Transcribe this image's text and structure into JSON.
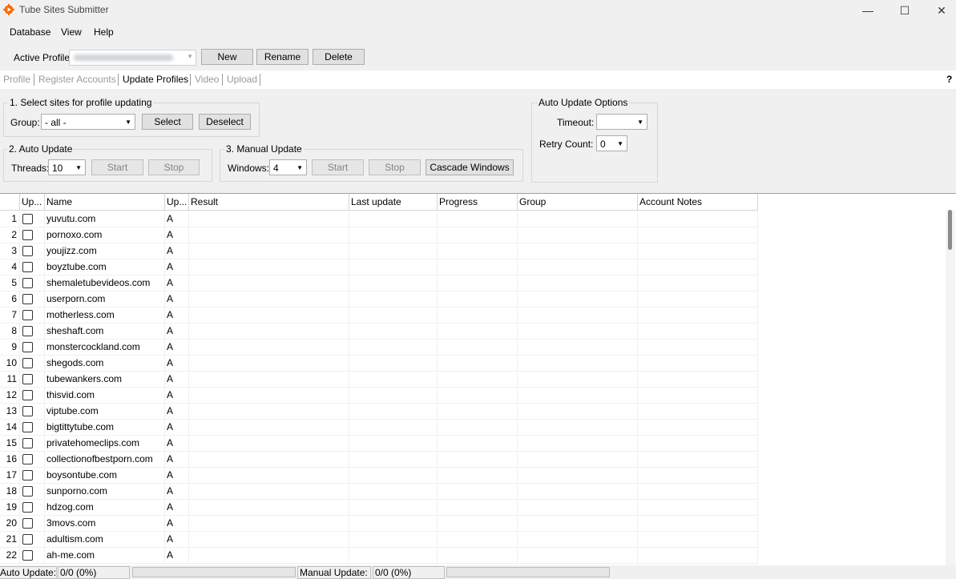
{
  "window": {
    "title": "Tube Sites Submitter",
    "minimize_glyph": "—",
    "maximize_glyph": "☐",
    "close_glyph": "✕",
    "icon": "app-gear-icon",
    "icon_color": "#ff6a00"
  },
  "menu": [
    "Database",
    "View",
    "Help"
  ],
  "profile": {
    "label": "Active Profile:",
    "buttons": {
      "new": "New",
      "rename": "Rename",
      "delete": "Delete"
    }
  },
  "tabs": [
    {
      "label": "Profile",
      "active": false
    },
    {
      "label": "Register Accounts",
      "active": false
    },
    {
      "label": "Update Profiles",
      "active": true
    },
    {
      "label": "Video",
      "active": false
    },
    {
      "label": "Upload",
      "active": false
    }
  ],
  "help_label": "?",
  "select_sites": {
    "title": "1. Select sites for profile updating",
    "group_label": "Group:",
    "group_value": "- all -",
    "select_button": "Select",
    "deselect_button": "Deselect"
  },
  "auto_update": {
    "title": "2. Auto Update",
    "threads_label": "Threads:",
    "threads_value": "10",
    "start_button": "Start",
    "stop_button": "Stop"
  },
  "manual_update": {
    "title": "3. Manual Update",
    "windows_label": "Windows:",
    "windows_value": "4",
    "start_button": "Start",
    "stop_button": "Stop",
    "cascade_button": "Cascade Windows"
  },
  "auto_update_options": {
    "title": "Auto Update Options",
    "timeout_label": "Timeout:",
    "timeout_value": "",
    "retry_label": "Retry Count:",
    "retry_value": "0"
  },
  "table": {
    "columns": [
      "Up...",
      "Name",
      "Up...",
      "Result",
      "Last update",
      "Progress",
      "Group",
      "Account Notes"
    ],
    "rows": [
      {
        "n": "1",
        "name": "yuvutu.com",
        "up": "A"
      },
      {
        "n": "2",
        "name": "pornoxo.com",
        "up": "A"
      },
      {
        "n": "3",
        "name": "youjizz.com",
        "up": "A"
      },
      {
        "n": "4",
        "name": "boyztube.com",
        "up": "A"
      },
      {
        "n": "5",
        "name": "shemaletubevideos.com",
        "up": "A"
      },
      {
        "n": "6",
        "name": "userporn.com",
        "up": "A"
      },
      {
        "n": "7",
        "name": "motherless.com",
        "up": "A"
      },
      {
        "n": "8",
        "name": "sheshaft.com",
        "up": "A"
      },
      {
        "n": "9",
        "name": "monstercockland.com",
        "up": "A"
      },
      {
        "n": "10",
        "name": "shegods.com",
        "up": "A"
      },
      {
        "n": "11",
        "name": "tubewankers.com",
        "up": "A"
      },
      {
        "n": "12",
        "name": "thisvid.com",
        "up": "A"
      },
      {
        "n": "13",
        "name": "viptube.com",
        "up": "A"
      },
      {
        "n": "14",
        "name": "bigtittytube.com",
        "up": "A"
      },
      {
        "n": "15",
        "name": "privatehomeclips.com",
        "up": "A"
      },
      {
        "n": "16",
        "name": "collectionofbestporn.com",
        "up": "A"
      },
      {
        "n": "17",
        "name": "boysontube.com",
        "up": "A"
      },
      {
        "n": "18",
        "name": "sunporno.com",
        "up": "A"
      },
      {
        "n": "19",
        "name": "hdzog.com",
        "up": "A"
      },
      {
        "n": "20",
        "name": "3movs.com",
        "up": "A"
      },
      {
        "n": "21",
        "name": "adultism.com",
        "up": "A"
      },
      {
        "n": "22",
        "name": "ah-me.com",
        "up": "A"
      }
    ]
  },
  "status": {
    "auto_label": "Auto Update:",
    "auto_value": "0/0 (0%)",
    "auto_progress": 0,
    "manual_label": "Manual Update:",
    "manual_value": "0/0 (0%)",
    "manual_progress": 0
  }
}
